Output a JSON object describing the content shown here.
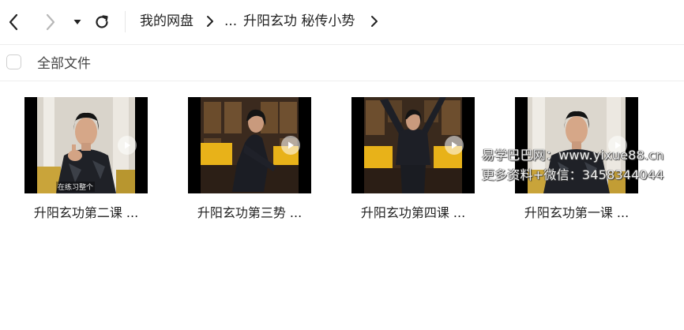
{
  "breadcrumb": {
    "root": "我的网盘",
    "ellipsis": "...",
    "current": "升阳玄功 秘传小势"
  },
  "select_all_label": "全部文件",
  "files": [
    {
      "name": "升阳玄功第二课 ...",
      "caption": "在练习整个"
    },
    {
      "name": "升阳玄功第三势 ..."
    },
    {
      "name": "升阳玄功第四课 ..."
    },
    {
      "name": "升阳玄功第一课 ..."
    }
  ],
  "watermark": {
    "line1": "易学巴巴网：www.yixue88.cn",
    "line2": "更多资料+微信：3458344044"
  },
  "icons": {
    "back": "chevron-left-icon",
    "forward": "chevron-right-icon",
    "history": "caret-down-icon",
    "refresh": "refresh-icon",
    "play": "play-icon"
  },
  "colors": {
    "text": "#222222",
    "disabled": "#b8b8b8",
    "border": "#eeeeee",
    "robe_yellow": "#e8b219"
  }
}
